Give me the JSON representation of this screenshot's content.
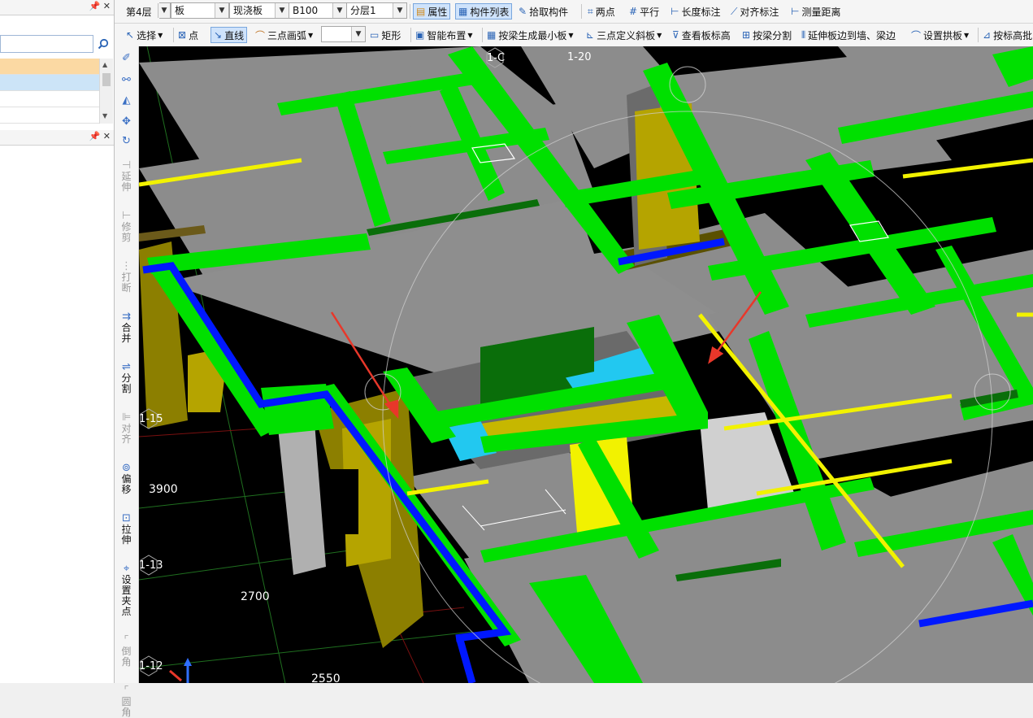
{
  "left_panel": {
    "search_placeholder": "",
    "pin_label": "ᵖ",
    "close_label": "✕"
  },
  "toolbar1": {
    "floor": "第4层",
    "component_type": "板",
    "slab_kind": "现浇板",
    "slab_name": "B100",
    "layer": "分层1",
    "properties": "属性",
    "component_list": "构件列表",
    "pick_component": "拾取构件",
    "two_points": "两点",
    "parallel": "平行",
    "length_mark": "长度标注",
    "align_mark": "对齐标注",
    "measure_distance": "测量距离"
  },
  "toolbar2": {
    "select": "选择",
    "point": "点",
    "line": "直线",
    "three_point_arc": "三点画弧",
    "rectangle": "矩形",
    "smart_layout": "智能布置",
    "min_slab_by_beam": "按梁生成最小板",
    "three_point_slope": "三点定义斜板",
    "view_slab_elevation": "查看板标高",
    "split_by_beam": "按梁分割",
    "extend_slab_edge": "延伸板边到墙、梁边",
    "set_arch_slab": "设置拱板",
    "by_elevation": "按标高批"
  },
  "vertical_tools": [
    {
      "label": "延伸",
      "enabled": false
    },
    {
      "label": "修剪",
      "enabled": false
    },
    {
      "label": "打断",
      "enabled": false
    },
    {
      "label": "合并",
      "enabled": true
    },
    {
      "label": "分割",
      "enabled": true
    },
    {
      "label": "对齐",
      "enabled": false
    },
    {
      "label": "偏移",
      "enabled": true
    },
    {
      "label": "拉伸",
      "enabled": true
    },
    {
      "label": "设置夹点",
      "enabled": true
    },
    {
      "label": "倒角",
      "enabled": false
    },
    {
      "label": "圆角",
      "enabled": false
    }
  ],
  "viewport": {
    "axis_labels": [
      "1-C",
      "1-20",
      "1-15",
      "1-13",
      "1-12"
    ],
    "dimensions": [
      "3900",
      "2700",
      "2550"
    ],
    "colors": {
      "background": "#000000",
      "slab": "#8c8c8c",
      "beam": "#00e000",
      "dark_beam": "#0a6e0a",
      "wall": "#b5a400",
      "blue_beam": "#0018ff",
      "yellow_line": "#f2f200",
      "stair": "#22c8f0",
      "arrow": "#e8372a"
    }
  }
}
